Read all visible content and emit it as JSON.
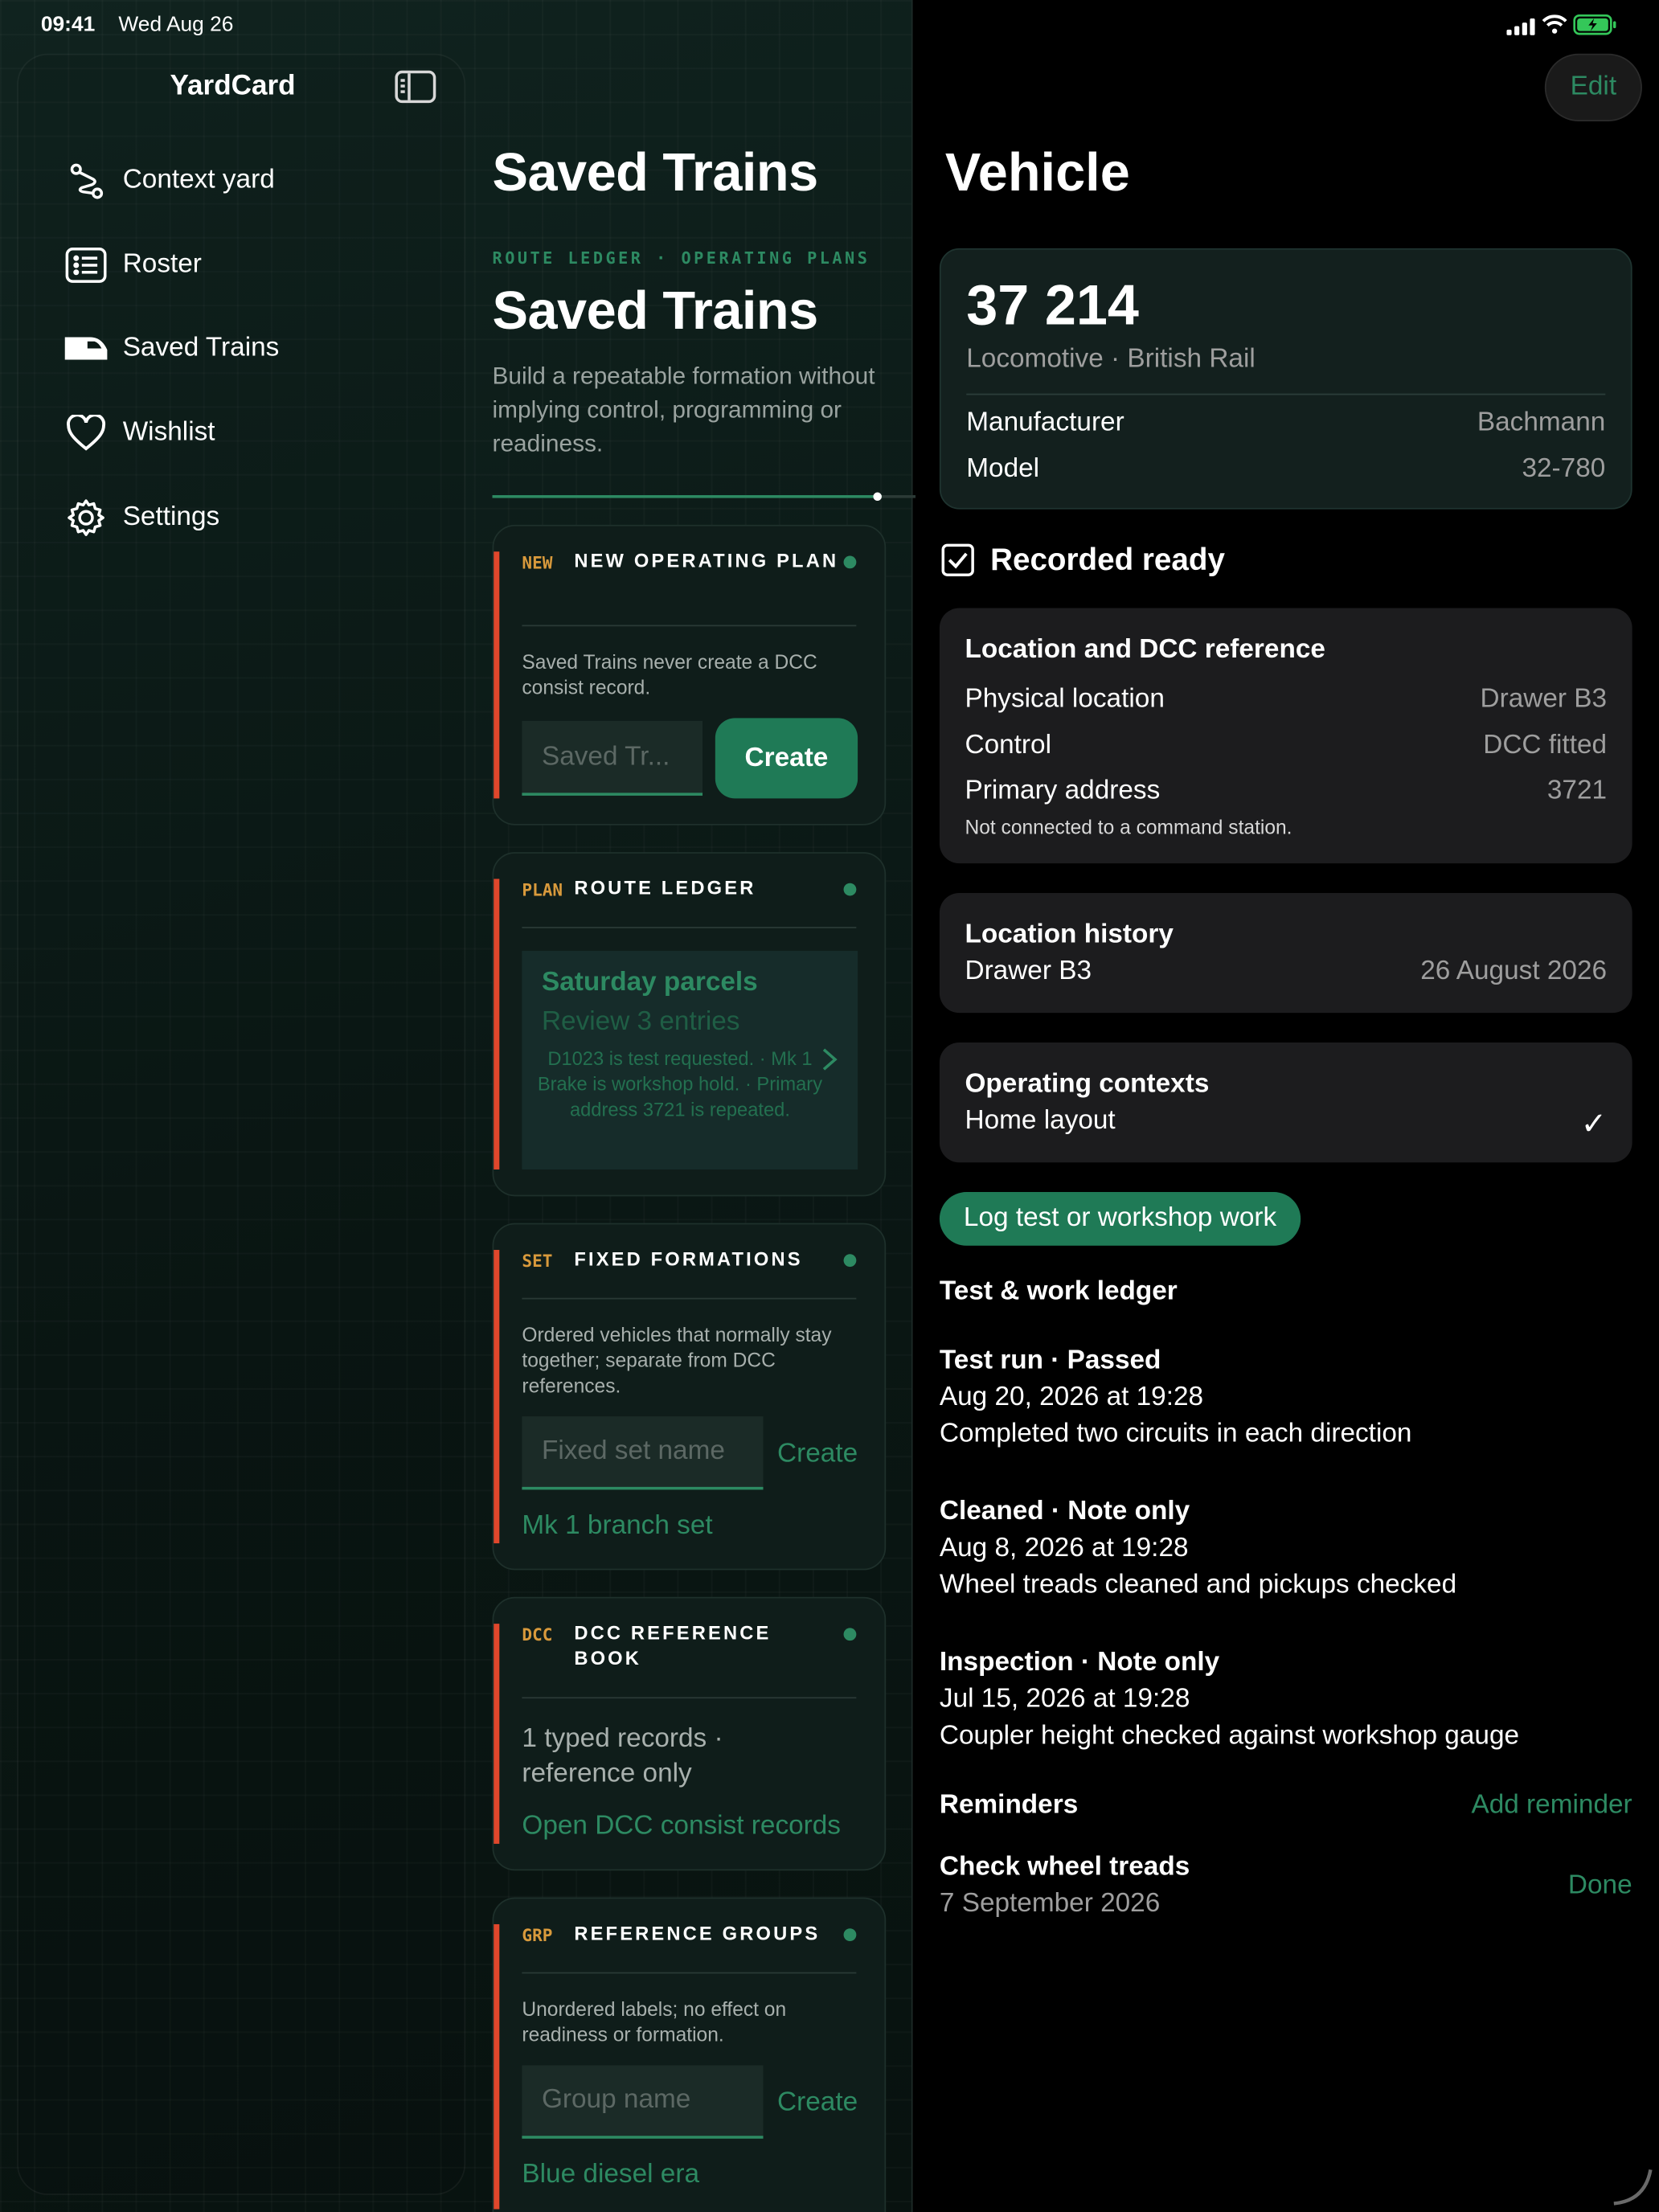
{
  "status_bar": {
    "time": "09:41",
    "date": "Wed Aug 26"
  },
  "sidebar": {
    "app_title": "YardCard",
    "items": [
      {
        "label": "Context yard",
        "icon": "route-icon"
      },
      {
        "label": "Roster",
        "icon": "list-icon"
      },
      {
        "label": "Saved Trains",
        "icon": "train-icon"
      },
      {
        "label": "Wishlist",
        "icon": "heart-icon"
      },
      {
        "label": "Settings",
        "icon": "gear-icon"
      }
    ]
  },
  "middle": {
    "nav_title": "Saved Trains",
    "eyebrow": "ROUTE LEDGER · OPERATING PLANS",
    "title": "Saved Trains",
    "subtitle": "Build a repeatable formation without implying control, programming or readiness.",
    "progress": 0.92,
    "cards": {
      "new_plan": {
        "tag": "NEW",
        "title": "NEW OPERATING PLAN",
        "body": "Saved Trains never create a DCC consist record.",
        "input_placeholder": "Saved Tr...",
        "button": "Create"
      },
      "route_ledger": {
        "tag": "PLAN",
        "title": "ROUTE LEDGER",
        "item_title": "Saturday parcels",
        "item_subtitle": "Review 3 entries",
        "item_detail": "D1023 is test requested. · Mk 1 Brake is workshop hold. · Primary address 3721 is repeated."
      },
      "fixed": {
        "tag": "SET",
        "title": "FIXED FORMATIONS",
        "body": "Ordered vehicles that normally stay together; separate from DCC references.",
        "input_placeholder": "Fixed set name",
        "button": "Create",
        "item": "Mk 1 branch set"
      },
      "dcc": {
        "tag": "DCC",
        "title": "DCC REFERENCE BOOK",
        "body": "1 typed records · reference only",
        "link": "Open DCC consist records"
      },
      "groups": {
        "tag": "GRP",
        "title": "REFERENCE GROUPS",
        "body": "Unordered labels; no effect on readiness or formation.",
        "input_placeholder": "Group name",
        "button": "Create",
        "item": "Blue diesel era"
      }
    }
  },
  "detail": {
    "edit_label": "Edit",
    "title": "Vehicle",
    "vehicle": {
      "number": "37 214",
      "subtitle": "Locomotive · British Rail",
      "manufacturer_label": "Manufacturer",
      "manufacturer": "Bachmann",
      "model_label": "Model",
      "model": "32-780"
    },
    "recorded_ready": {
      "label": "Recorded ready",
      "checked": true
    },
    "location": {
      "title": "Location and DCC reference",
      "physical_label": "Physical location",
      "physical": "Drawer B3",
      "control_label": "Control",
      "control": "DCC fitted",
      "address_label": "Primary address",
      "address": "3721",
      "note": "Not connected to a command station."
    },
    "history": {
      "title": "Location history",
      "place": "Drawer B3",
      "date": "26 August 2026"
    },
    "contexts": {
      "title": "Operating contexts",
      "item": "Home layout",
      "check": "✓"
    },
    "log_button": "Log test or workshop work",
    "ledger_title": "Test & work ledger",
    "ledger": [
      {
        "title": "Test run · Passed",
        "date": "Aug 20, 2026 at 19:28",
        "note": "Completed two circuits in each direction"
      },
      {
        "title": "Cleaned · Note only",
        "date": "Aug 8, 2026 at 19:28",
        "note": "Wheel treads cleaned and pickups checked"
      },
      {
        "title": "Inspection · Note only",
        "date": "Jul 15, 2026 at 19:28",
        "note": "Coupler height checked against workshop gauge"
      }
    ],
    "reminders_title": "Reminders",
    "add_reminder": "Add reminder",
    "reminder": {
      "title": "Check wheel treads",
      "date": "7 September 2026",
      "action": "Done"
    }
  },
  "colors": {
    "accent": "#2d8a62",
    "warning_bar": "#e0472c",
    "tag": "#d99a3c",
    "left_bg": "#0b1916",
    "card_bg": "#0f1d1a",
    "panel_bg": "#1c1c1e"
  }
}
